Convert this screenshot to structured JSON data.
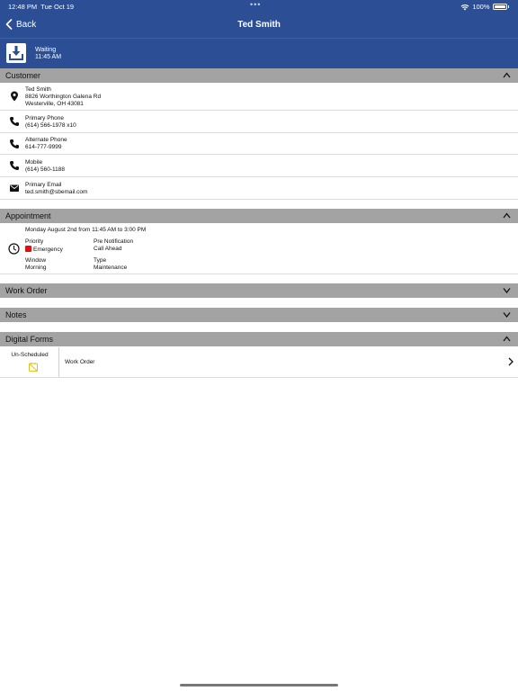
{
  "status_bar": {
    "time": "12:48 PM",
    "date": "Tue Oct 19",
    "dots": "•••",
    "battery": "100%"
  },
  "nav": {
    "back_label": "Back",
    "title": "Ted Smith"
  },
  "job_status": {
    "state": "Waiting",
    "time": "11:45 AM"
  },
  "sections": {
    "customer": "Customer",
    "appointment": "Appointment",
    "work_order": "Work Order",
    "notes": "Notes",
    "digital_forms": "Digital Forms"
  },
  "customer": {
    "name": "Ted Smith",
    "address_line1": "8826 Worthington Galena Rd",
    "address_line2": "Westerville, OH 43081",
    "primary_phone_label": "Primary Phone",
    "primary_phone": "(614) 566-1978 x10",
    "alternate_phone_label": "Alternate Phone",
    "alternate_phone": "614-777-9999",
    "mobile_label": "Mobile",
    "mobile": "(614) 560-1188",
    "email_label": "Primary Email",
    "email": "ted.smith@sbemail.com"
  },
  "appointment": {
    "when": "Monday August 2nd from 11:45 AM to 3:00 PM",
    "priority_label": "Priority",
    "priority": "Emergency",
    "pre_notification_label": "Pre Notification",
    "pre_notification": "Call Ahead",
    "window_label": "Window",
    "window": "Morning",
    "type_label": "Type",
    "type": "Maintenance"
  },
  "digital_forms": [
    {
      "status": "Un-Scheduled",
      "name": "Work Order"
    }
  ],
  "colors": {
    "header_blue": "#2b4e94",
    "section_gray": "#a3a3a3",
    "emergency_red": "#d11111",
    "badge_yellow": "#e8c21a"
  }
}
